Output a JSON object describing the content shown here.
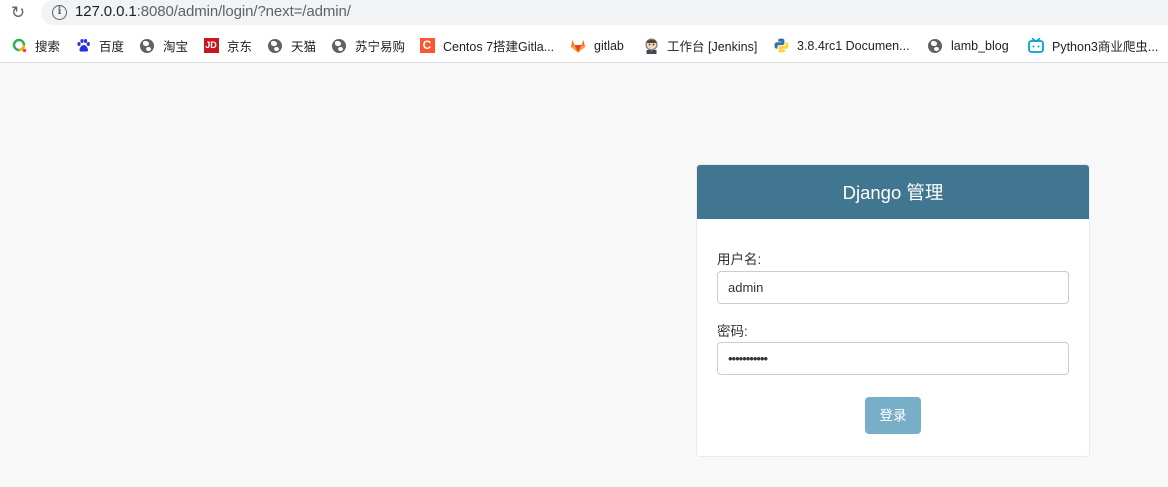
{
  "browser": {
    "url_host": "127.0.0.1",
    "url_path": ":8080/admin/login/?next=/admin/",
    "icons": {
      "reload": "reload-icon",
      "info": "info-icon"
    }
  },
  "bookmarks": [
    {
      "label": "搜索",
      "icon": "search-ring-icon"
    },
    {
      "label": "百度",
      "icon": "baidu-paw-icon"
    },
    {
      "label": "淘宝",
      "icon": "globe-icon"
    },
    {
      "label": "京东",
      "icon": "jd-icon",
      "icon_text": "JD"
    },
    {
      "label": "天猫",
      "icon": "globe-icon"
    },
    {
      "label": "苏宁易购",
      "icon": "globe-icon"
    },
    {
      "label": "Centos 7搭建Gitla...",
      "icon": "csdn-icon",
      "icon_text": "C"
    },
    {
      "label": "gitlab",
      "icon": "gitlab-icon"
    },
    {
      "label": "工作台 [Jenkins]",
      "icon": "jenkins-icon"
    },
    {
      "label": "3.8.4rc1 Documen...",
      "icon": "python-icon"
    },
    {
      "label": "lamb_blog",
      "icon": "globe-icon"
    },
    {
      "label": "Python3商业爬虫...",
      "icon": "bilibili-icon"
    }
  ],
  "login": {
    "title": "Django 管理",
    "username_label": "用户名:",
    "username_value": "admin",
    "password_label": "密码:",
    "password_value": "•••••••••••",
    "submit_label": "登录"
  },
  "colors": {
    "header": "#417690",
    "button": "#79aec8",
    "page_background": "#f8f8f8"
  }
}
